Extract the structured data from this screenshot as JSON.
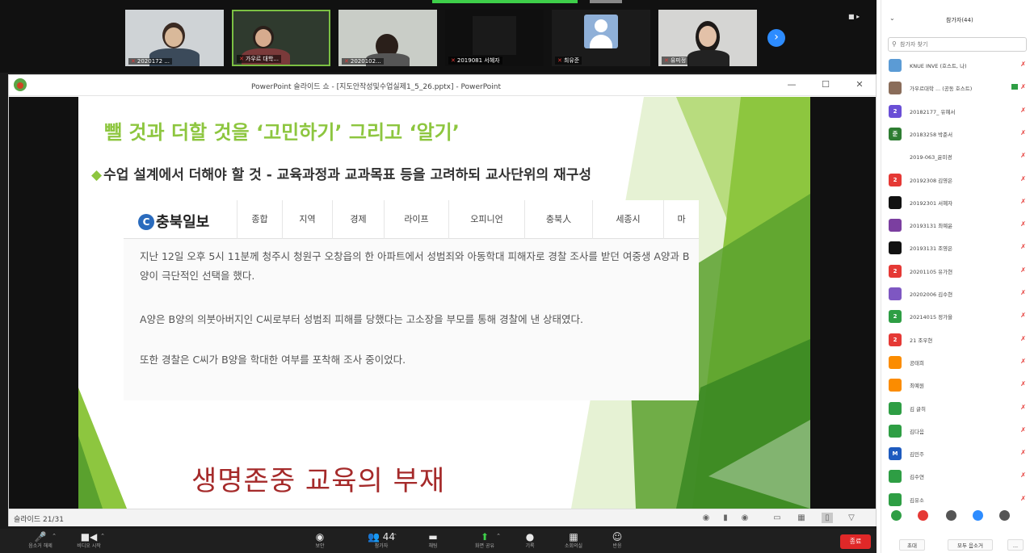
{
  "videos": [
    {
      "name": "2020172 ...",
      "muted": true
    },
    {
      "name": "가우르 대학...",
      "muted": true
    },
    {
      "name": "2020102...",
      "muted": true
    },
    {
      "name": "2019081 서혜자",
      "muted": true
    },
    {
      "name": "최유준",
      "muted": true
    },
    {
      "name": "유미정",
      "muted": true
    },
    {
      "name": "",
      "muted": false
    }
  ],
  "strip": {
    "next_symbol": "›",
    "view_label": "■ ▸"
  },
  "ppt": {
    "window_title": "PowerPoint 슬라이드 쇼 - [지도안작성및수업실제1_5_26.pptx] - PowerPoint",
    "minimize": "—",
    "maximize": "☐",
    "close": "✕",
    "slide": {
      "title": "뺄 것과 더할 것을 ‘고민하기’ 그리고 ‘알기’",
      "bullet": "◆",
      "subtitle": "수업 설계에서 더해야 할 것 - 교육과정과 교과목표 등을 고려하되 교사단위의 재구성",
      "news": {
        "logo_mark": "C",
        "logo": "충북일보",
        "nav": [
          "종합",
          "지역",
          "경제",
          "라이프",
          "오피니언",
          "충북人",
          "세종시",
          "마"
        ],
        "paragraphs": [
          "지난 12일 오후 5시 11분께 청주시 청원구 오창읍의 한 아파트에서 성범죄와 아동학대 피해자로 경찰 조사를 받던 여중생 A양과 B양이 극단적인 선택을 했다.",
          "A양은 B양의 의붓아버지인 C씨로부터 성범죄 피해를 당했다는 고소장을 부모를 통해 경찰에 낸 상태였다.",
          "또한 경찰은 C씨가 B양을 학대한 여부를 포착해 조사 중이었다."
        ]
      },
      "big_text": "생명존중 교육의 부재"
    },
    "status": {
      "counter": "슬라이드 21/31"
    }
  },
  "toolbar": {
    "items": [
      {
        "icon": "🎤",
        "label": "음소거 해제",
        "name": "mute"
      },
      {
        "icon": "■◀",
        "label": "비디오 시작",
        "name": "video"
      },
      {
        "icon": "◉",
        "label": "보안",
        "name": "security"
      },
      {
        "icon": "👥 44",
        "label": "참가자",
        "name": "participants"
      },
      {
        "icon": "▬",
        "label": "채팅",
        "name": "chat"
      },
      {
        "icon": "⬆",
        "label": "화면 공유",
        "name": "share-screen"
      },
      {
        "icon": "●",
        "label": "기록",
        "name": "record"
      },
      {
        "icon": "▦",
        "label": "소회의실",
        "name": "breakout"
      },
      {
        "icon": "☺",
        "label": "반응",
        "name": "reactions"
      }
    ],
    "end_label": "종료"
  },
  "panel": {
    "title": "참가자(44)",
    "collapse": "⌄",
    "search_placeholder": "참가자 찾기",
    "participants": [
      {
        "initial": "",
        "name": "KNUE INVE (호스트, 나)",
        "color": "#5b9bd5",
        "video": false
      },
      {
        "initial": "",
        "name": "가우르대학 ... (공동 호스트)",
        "color": "#8a6d5a",
        "video": true
      },
      {
        "initial": "2",
        "name": "20182177_ 유혜서",
        "color": "#6a4fd6",
        "video": false
      },
      {
        "initial": "준",
        "name": "20183258 박준서",
        "color": "#2e7d32",
        "video": false
      },
      {
        "initial": "",
        "name": "2019-063_윤미경",
        "color": "#ffffff",
        "video": false
      },
      {
        "initial": "2",
        "name": "20192308 김영은",
        "color": "#e53935",
        "video": false
      },
      {
        "initial": "",
        "name": "20192301 서혜자",
        "color": "#111111",
        "video": false
      },
      {
        "initial": "",
        "name": "20193131 최예윤",
        "color": "#7b3fa0",
        "video": false
      },
      {
        "initial": "",
        "name": "20193131 조영은",
        "color": "#111111",
        "video": false
      },
      {
        "initial": "2",
        "name": "20201105 유가현",
        "color": "#e53935",
        "video": false
      },
      {
        "initial": "",
        "name": "20202006 김수현",
        "color": "#7e57c2",
        "video": false
      },
      {
        "initial": "2",
        "name": "20214015 정가을",
        "color": "#2e9e44",
        "video": false
      },
      {
        "initial": "2",
        "name": "21 조우현",
        "color": "#e53935",
        "video": false
      },
      {
        "initial": "",
        "name": "공태희",
        "color": "#fb8c00",
        "video": false
      },
      {
        "initial": "",
        "name": "최예원",
        "color": "#fb8c00",
        "video": false
      },
      {
        "initial": "",
        "name": "김 글히",
        "color": "#2e9e44",
        "video": false
      },
      {
        "initial": "",
        "name": "김다음",
        "color": "#2e9e44",
        "video": false
      },
      {
        "initial": "M",
        "name": "김민주",
        "color": "#1e5bbf",
        "video": false
      },
      {
        "initial": "",
        "name": "김수연",
        "color": "#2e9e44",
        "video": false
      },
      {
        "initial": "",
        "name": "김유소",
        "color": "#2e9e44",
        "video": false
      }
    ],
    "reactions": [
      "#2e9e44",
      "#e53935",
      "#555555",
      "#2d8cff",
      "#555555"
    ],
    "invite_label": "초대",
    "mute_all_label": "모두 음소거",
    "more_label": "..."
  },
  "colors": {
    "accent_green": "#8dc63f",
    "slide_red": "#a52a2a",
    "zoom_blue": "#2d8cff",
    "end_red": "#e02828"
  }
}
